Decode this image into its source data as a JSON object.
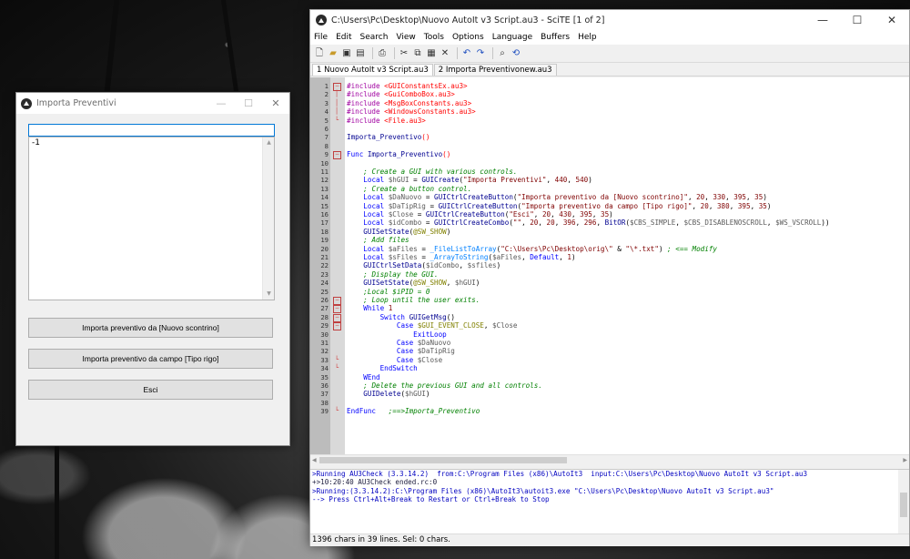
{
  "dialog": {
    "title": "Importa Preventivi",
    "controls": [
      "—",
      "☐",
      "✕"
    ],
    "combo_value": "",
    "list_items": [
      "-1"
    ],
    "buttons": [
      {
        "label": "Importa preventivo da [Nuovo scontrino]"
      },
      {
        "label": "Importa preventivo da campo [Tipo rigo]"
      },
      {
        "label": "Esci"
      }
    ]
  },
  "scite": {
    "title": "C:\\Users\\Pc\\Desktop\\Nuovo AutoIt v3 Script.au3 - SciTE [1 of 2]",
    "controls": [
      "—",
      "☐",
      "✕"
    ],
    "menu": [
      "File",
      "Edit",
      "Search",
      "View",
      "Tools",
      "Options",
      "Language",
      "Buffers",
      "Help"
    ],
    "tabs": [
      "1 Nuovo AutoIt v3 Script.au3",
      "2 Importa Preventivonew.au3"
    ],
    "code": [
      [
        {
          "c": "t-inc",
          "t": "#include "
        },
        {
          "c": "t-incf",
          "t": "<GUIConstantsEx.au3>"
        }
      ],
      [
        {
          "c": "t-inc",
          "t": "#include "
        },
        {
          "c": "t-incf",
          "t": "<GuiComboBox.au3>"
        }
      ],
      [
        {
          "c": "t-inc",
          "t": "#include "
        },
        {
          "c": "t-incf",
          "t": "<MsgBoxConstants.au3>"
        }
      ],
      [
        {
          "c": "t-inc",
          "t": "#include "
        },
        {
          "c": "t-incf",
          "t": "<WindowsConstants.au3>"
        }
      ],
      [
        {
          "c": "t-inc",
          "t": "#include "
        },
        {
          "c": "t-incf",
          "t": "<File.au3>"
        }
      ],
      [],
      [
        {
          "c": "t-fn",
          "t": "Importa_Preventivo"
        },
        {
          "c": "t-op",
          "t": "()"
        }
      ],
      [],
      [
        {
          "c": "t-kw",
          "t": "Func "
        },
        {
          "c": "t-fn",
          "t": "Importa_Preventivo"
        },
        {
          "c": "t-op",
          "t": "()"
        }
      ],
      [],
      [
        {
          "c": "",
          "t": "    "
        },
        {
          "c": "t-com",
          "t": "; Create a GUI with various controls."
        }
      ],
      [
        {
          "c": "",
          "t": "    "
        },
        {
          "c": "t-kw",
          "t": "Local "
        },
        {
          "c": "t-var",
          "t": "$hGUI"
        },
        {
          "c": "",
          "t": " = "
        },
        {
          "c": "t-fn",
          "t": "GUICreate"
        },
        {
          "c": "",
          "t": "("
        },
        {
          "c": "t-str",
          "t": "\"Importa Preventivi\""
        },
        {
          "c": "",
          "t": ", "
        },
        {
          "c": "t-num",
          "t": "440"
        },
        {
          "c": "",
          "t": ", "
        },
        {
          "c": "t-num",
          "t": "540"
        },
        {
          "c": "",
          "t": ")"
        }
      ],
      [
        {
          "c": "",
          "t": "    "
        },
        {
          "c": "t-com",
          "t": "; Create a button control."
        }
      ],
      [
        {
          "c": "",
          "t": "    "
        },
        {
          "c": "t-kw",
          "t": "Local "
        },
        {
          "c": "t-var",
          "t": "$DaNuovo"
        },
        {
          "c": "",
          "t": " = "
        },
        {
          "c": "t-fn",
          "t": "GUICtrlCreateButton"
        },
        {
          "c": "",
          "t": "("
        },
        {
          "c": "t-str",
          "t": "\"Importa preventivo da [Nuovo scontrino]\""
        },
        {
          "c": "",
          "t": ", "
        },
        {
          "c": "t-num",
          "t": "20"
        },
        {
          "c": "",
          "t": ", "
        },
        {
          "c": "t-num",
          "t": "330"
        },
        {
          "c": "",
          "t": ", "
        },
        {
          "c": "t-num",
          "t": "395"
        },
        {
          "c": "",
          "t": ", "
        },
        {
          "c": "t-num",
          "t": "35"
        },
        {
          "c": "",
          "t": ")"
        }
      ],
      [
        {
          "c": "",
          "t": "    "
        },
        {
          "c": "t-kw",
          "t": "Local "
        },
        {
          "c": "t-var",
          "t": "$DaTipRig"
        },
        {
          "c": "",
          "t": " = "
        },
        {
          "c": "t-fn",
          "t": "GUICtrlCreateButton"
        },
        {
          "c": "",
          "t": "("
        },
        {
          "c": "t-str",
          "t": "\"Importa preventivo da campo [Tipo rigo]\""
        },
        {
          "c": "",
          "t": ", "
        },
        {
          "c": "t-num",
          "t": "20"
        },
        {
          "c": "",
          "t": ", "
        },
        {
          "c": "t-num",
          "t": "380"
        },
        {
          "c": "",
          "t": ", "
        },
        {
          "c": "t-num",
          "t": "395"
        },
        {
          "c": "",
          "t": ", "
        },
        {
          "c": "t-num",
          "t": "35"
        },
        {
          "c": "",
          "t": ")"
        }
      ],
      [
        {
          "c": "",
          "t": "    "
        },
        {
          "c": "t-kw",
          "t": "Local "
        },
        {
          "c": "t-var",
          "t": "$Close"
        },
        {
          "c": "",
          "t": " = "
        },
        {
          "c": "t-fn",
          "t": "GUICtrlCreateButton"
        },
        {
          "c": "",
          "t": "("
        },
        {
          "c": "t-str",
          "t": "\"Esci\""
        },
        {
          "c": "",
          "t": ", "
        },
        {
          "c": "t-num",
          "t": "20"
        },
        {
          "c": "",
          "t": ", "
        },
        {
          "c": "t-num",
          "t": "430"
        },
        {
          "c": "",
          "t": ", "
        },
        {
          "c": "t-num",
          "t": "395"
        },
        {
          "c": "",
          "t": ", "
        },
        {
          "c": "t-num",
          "t": "35"
        },
        {
          "c": "",
          "t": ")"
        }
      ],
      [
        {
          "c": "",
          "t": "    "
        },
        {
          "c": "t-kw",
          "t": "Local "
        },
        {
          "c": "t-var",
          "t": "$idCombo"
        },
        {
          "c": "",
          "t": " = "
        },
        {
          "c": "t-fn",
          "t": "GUICtrlCreateCombo"
        },
        {
          "c": "",
          "t": "("
        },
        {
          "c": "t-str",
          "t": "\"\""
        },
        {
          "c": "",
          "t": ", "
        },
        {
          "c": "t-num",
          "t": "20"
        },
        {
          "c": "",
          "t": ", "
        },
        {
          "c": "t-num",
          "t": "20"
        },
        {
          "c": "",
          "t": ", "
        },
        {
          "c": "t-num",
          "t": "396"
        },
        {
          "c": "",
          "t": ", "
        },
        {
          "c": "t-num",
          "t": "296"
        },
        {
          "c": "",
          "t": ", "
        },
        {
          "c": "t-fn",
          "t": "BitOR"
        },
        {
          "c": "",
          "t": "("
        },
        {
          "c": "t-var",
          "t": "$CBS_SIMPLE"
        },
        {
          "c": "",
          "t": ", "
        },
        {
          "c": "t-var",
          "t": "$CBS_DISABLENOSCROLL"
        },
        {
          "c": "",
          "t": ", "
        },
        {
          "c": "t-var",
          "t": "$WS_VSCROLL"
        },
        {
          "c": "",
          "t": "))"
        }
      ],
      [
        {
          "c": "",
          "t": "    "
        },
        {
          "c": "t-fn",
          "t": "GUISetState"
        },
        {
          "c": "",
          "t": "("
        },
        {
          "c": "t-mac",
          "t": "@SW_SHOW"
        },
        {
          "c": "",
          "t": ")"
        }
      ],
      [
        {
          "c": "",
          "t": "    "
        },
        {
          "c": "t-com",
          "t": "; Add files"
        }
      ],
      [
        {
          "c": "",
          "t": "    "
        },
        {
          "c": "t-kw",
          "t": "Local "
        },
        {
          "c": "t-var",
          "t": "$aFiles"
        },
        {
          "c": "",
          "t": " = "
        },
        {
          "c": "t-udf",
          "t": "_FileListToArray"
        },
        {
          "c": "",
          "t": "("
        },
        {
          "c": "t-str",
          "t": "\"C:\\Users\\Pc\\Desktop\\orig\\\""
        },
        {
          "c": "",
          "t": " & "
        },
        {
          "c": "t-str",
          "t": "\"\\*.txt\""
        },
        {
          "c": "",
          "t": ") "
        },
        {
          "c": "t-com",
          "t": "; <== Modify"
        }
      ],
      [
        {
          "c": "",
          "t": "    "
        },
        {
          "c": "t-kw",
          "t": "Local "
        },
        {
          "c": "t-var",
          "t": "$sFiles"
        },
        {
          "c": "",
          "t": " = "
        },
        {
          "c": "t-udf",
          "t": "_ArrayToString"
        },
        {
          "c": "",
          "t": "("
        },
        {
          "c": "t-var",
          "t": "$aFiles"
        },
        {
          "c": "",
          "t": ", "
        },
        {
          "c": "t-kw",
          "t": "Default"
        },
        {
          "c": "",
          "t": ", "
        },
        {
          "c": "t-num",
          "t": "1"
        },
        {
          "c": "",
          "t": ")"
        }
      ],
      [
        {
          "c": "",
          "t": "    "
        },
        {
          "c": "t-fn",
          "t": "GUICtrlSetData"
        },
        {
          "c": "",
          "t": "("
        },
        {
          "c": "t-var",
          "t": "$idCombo"
        },
        {
          "c": "",
          "t": ", "
        },
        {
          "c": "t-var",
          "t": "$sfiles"
        },
        {
          "c": "",
          "t": ")"
        }
      ],
      [
        {
          "c": "",
          "t": "    "
        },
        {
          "c": "t-com",
          "t": "; Display the GUI."
        }
      ],
      [
        {
          "c": "",
          "t": "    "
        },
        {
          "c": "t-fn",
          "t": "GUISetState"
        },
        {
          "c": "",
          "t": "("
        },
        {
          "c": "t-mac",
          "t": "@SW_SHOW"
        },
        {
          "c": "",
          "t": ", "
        },
        {
          "c": "t-var",
          "t": "$hGUI"
        },
        {
          "c": "",
          "t": ")"
        }
      ],
      [
        {
          "c": "",
          "t": "    "
        },
        {
          "c": "t-com",
          "t": ";Local $iPID = 0"
        }
      ],
      [
        {
          "c": "",
          "t": "    "
        },
        {
          "c": "t-com",
          "t": "; Loop until the user exits."
        }
      ],
      [
        {
          "c": "",
          "t": "    "
        },
        {
          "c": "t-kw",
          "t": "While "
        },
        {
          "c": "t-num",
          "t": "1"
        }
      ],
      [
        {
          "c": "",
          "t": "        "
        },
        {
          "c": "t-kw",
          "t": "Switch "
        },
        {
          "c": "t-fn",
          "t": "GUIGetMsg"
        },
        {
          "c": "",
          "t": "()"
        }
      ],
      [
        {
          "c": "",
          "t": "            "
        },
        {
          "c": "t-kw",
          "t": "Case "
        },
        {
          "c": "t-mac",
          "t": "$GUI_EVENT_CLOSE"
        },
        {
          "c": "",
          "t": ", "
        },
        {
          "c": "t-var",
          "t": "$Close"
        }
      ],
      [
        {
          "c": "",
          "t": "                "
        },
        {
          "c": "t-kw",
          "t": "ExitLoop"
        }
      ],
      [
        {
          "c": "",
          "t": "            "
        },
        {
          "c": "t-kw",
          "t": "Case "
        },
        {
          "c": "t-var",
          "t": "$DaNuovo"
        }
      ],
      [
        {
          "c": "",
          "t": "            "
        },
        {
          "c": "t-kw",
          "t": "Case "
        },
        {
          "c": "t-var",
          "t": "$DaTipRig"
        }
      ],
      [
        {
          "c": "",
          "t": "            "
        },
        {
          "c": "t-kw",
          "t": "Case "
        },
        {
          "c": "t-var",
          "t": "$Close"
        }
      ],
      [
        {
          "c": "",
          "t": "        "
        },
        {
          "c": "t-kw",
          "t": "EndSwitch"
        }
      ],
      [
        {
          "c": "",
          "t": "    "
        },
        {
          "c": "t-kw",
          "t": "WEnd"
        }
      ],
      [
        {
          "c": "",
          "t": "    "
        },
        {
          "c": "t-com",
          "t": "; Delete the previous GUI and all controls."
        }
      ],
      [
        {
          "c": "",
          "t": "    "
        },
        {
          "c": "t-fn",
          "t": "GUIDelete"
        },
        {
          "c": "",
          "t": "("
        },
        {
          "c": "t-var",
          "t": "$hGUI"
        },
        {
          "c": "",
          "t": ")"
        }
      ],
      [],
      [
        {
          "c": "t-kw",
          "t": "EndFunc"
        },
        {
          "c": "",
          "t": "   "
        },
        {
          "c": "t-com",
          "t": ";==>Importa_Preventivo"
        }
      ]
    ],
    "folds": {
      "1": "box",
      "2": "line",
      "3": "line",
      "4": "line",
      "5": "end",
      "9": "box",
      "26": "box",
      "27": "box",
      "28": "box",
      "29": "box",
      "33": "end",
      "34": "end",
      "39": "end"
    },
    "output": [
      {
        "c": "o-blue",
        "t": ">Running AU3Check (3.3.14.2)  from:C:\\Program Files (x86)\\AutoIt3  input:C:\\Users\\Pc\\Desktop\\Nuovo AutoIt v3 Script.au3"
      },
      {
        "c": "o-dark",
        "t": "+>10:20:40 AU3Check ended.rc:0"
      },
      {
        "c": "o-blue",
        "t": ">Running:(3.3.14.2):C:\\Program Files (x86)\\AutoIt3\\autoit3.exe \"C:\\Users\\Pc\\Desktop\\Nuovo AutoIt v3 Script.au3\""
      },
      {
        "c": "o-blue",
        "t": "--> Press Ctrl+Alt+Break to Restart or Ctrl+Break to Stop"
      }
    ],
    "status": "1396 chars in 39 lines. Sel: 0 chars."
  }
}
